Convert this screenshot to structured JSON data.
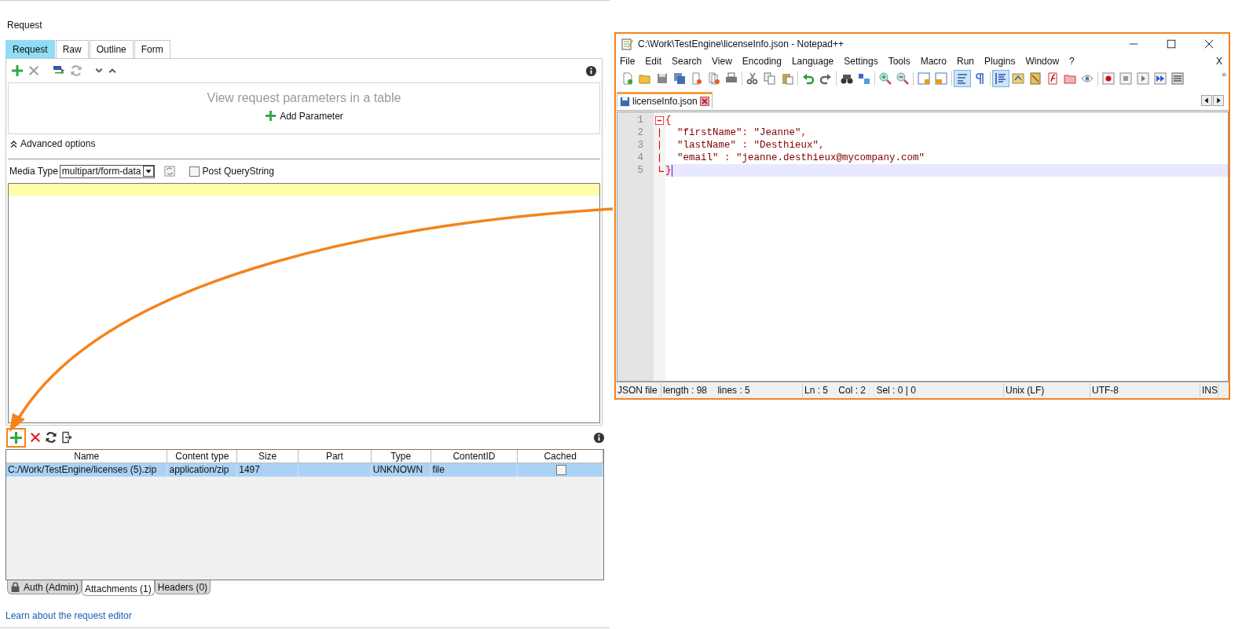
{
  "request_panel": {
    "title": "Request",
    "tabs": [
      {
        "label": "Request",
        "selected": true
      },
      {
        "label": "Raw",
        "selected": false
      },
      {
        "label": "Outline",
        "selected": false
      },
      {
        "label": "Form",
        "selected": false
      }
    ],
    "parameters": {
      "hint": "View request parameters in a table",
      "add_label": "Add Parameter"
    },
    "advanced_options": {
      "label": "Advanced options",
      "expanded": true
    },
    "media_type": {
      "label": "Media Type",
      "value": "multipart/form-data"
    },
    "post_querystring": {
      "label": "Post QueryString",
      "checked": false
    },
    "attachments": {
      "add_highlighted": true,
      "columns": [
        "Name",
        "Content type",
        "Size",
        "Part",
        "Type",
        "ContentID",
        "Cached"
      ],
      "rows": [
        {
          "cells": [
            "C:/Work/TestEngine/licenses (5).zip",
            "application/zip",
            "1497",
            "",
            "UNKNOWN",
            "file"
          ],
          "cached": false,
          "selected": true
        }
      ]
    },
    "bottom_tabs": [
      {
        "label": "Auth (Admin)",
        "kind": "locked",
        "selected": false
      },
      {
        "label": "Attachments (1)",
        "kind": "plain",
        "selected": true
      },
      {
        "label": "Headers (0)",
        "kind": "plain",
        "selected": false
      }
    ],
    "help_link": "Learn about the request editor"
  },
  "notepad": {
    "title": "C:\\Work\\TestEngine\\licenseInfo.json - Notepad++",
    "menu": [
      "File",
      "Edit",
      "Search",
      "View",
      "Encoding",
      "Language",
      "Settings",
      "Tools",
      "Macro",
      "Run",
      "Plugins",
      "Window",
      "?"
    ],
    "menu_close": "X",
    "overflow": "»",
    "file_tab": {
      "label": "licenseInfo.json",
      "selected": true
    },
    "lines": [
      {
        "number": "1",
        "text": "{",
        "current": false
      },
      {
        "number": "2",
        "text": "  \"firstName\": \"Jeanne\",",
        "current": false
      },
      {
        "number": "3",
        "text": "  \"lastName\" : \"Desthieux\",",
        "current": false
      },
      {
        "number": "4",
        "text": "  \"email\" : \"jeanne.desthieux@mycompany.com\"",
        "current": false
      },
      {
        "number": "5",
        "text": "}",
        "current": true
      }
    ],
    "status_bar": [
      "JSON file",
      "length : 98    lines : 5",
      "Ln : 5    Col : 2    Sel : 0 | 0",
      "Unix (LF)",
      "UTF-8",
      "INS"
    ]
  }
}
